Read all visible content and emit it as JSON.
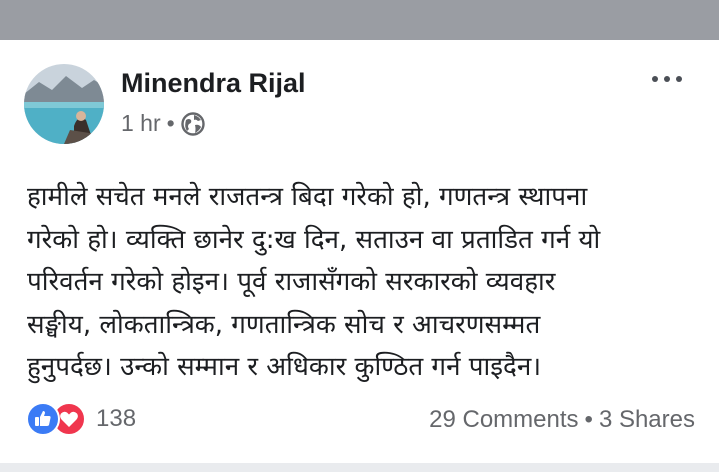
{
  "author": {
    "name": "Minendra Rijal"
  },
  "meta": {
    "time": "1 hr",
    "separator": "•",
    "audience_icon": "globe-icon"
  },
  "post": {
    "lines": [
      "हामीले सचेत मनले राजतन्त्र बिदा गरेको हो, गणतन्त्र स्थापना",
      "गरेको हो। व्यक्ति छानेर दु:ख दिन, सताउन वा प्रताडित गर्न यो",
      "परिवर्तन गरेको होइन। पूर्व राजासँगको सरकारको व्यवहार",
      "सङ्घीय, लोकतान्त्रिक, गणतान्त्रिक सोच र आचरणसम्मत",
      "हुनुपर्दछ। उन्को सम्मान र अधिकार कुण्ठित गर्न पाइदैन।"
    ]
  },
  "reactions": {
    "count": "138",
    "icons": [
      "like-icon",
      "love-icon"
    ]
  },
  "engagement": {
    "comments": "29 Comments",
    "separator": "•",
    "shares": "3 Shares"
  },
  "colors": {
    "like": "#3b7bf5",
    "love": "#f0364e",
    "secondary_text": "#65676b",
    "top_bar": "#9a9da3"
  }
}
